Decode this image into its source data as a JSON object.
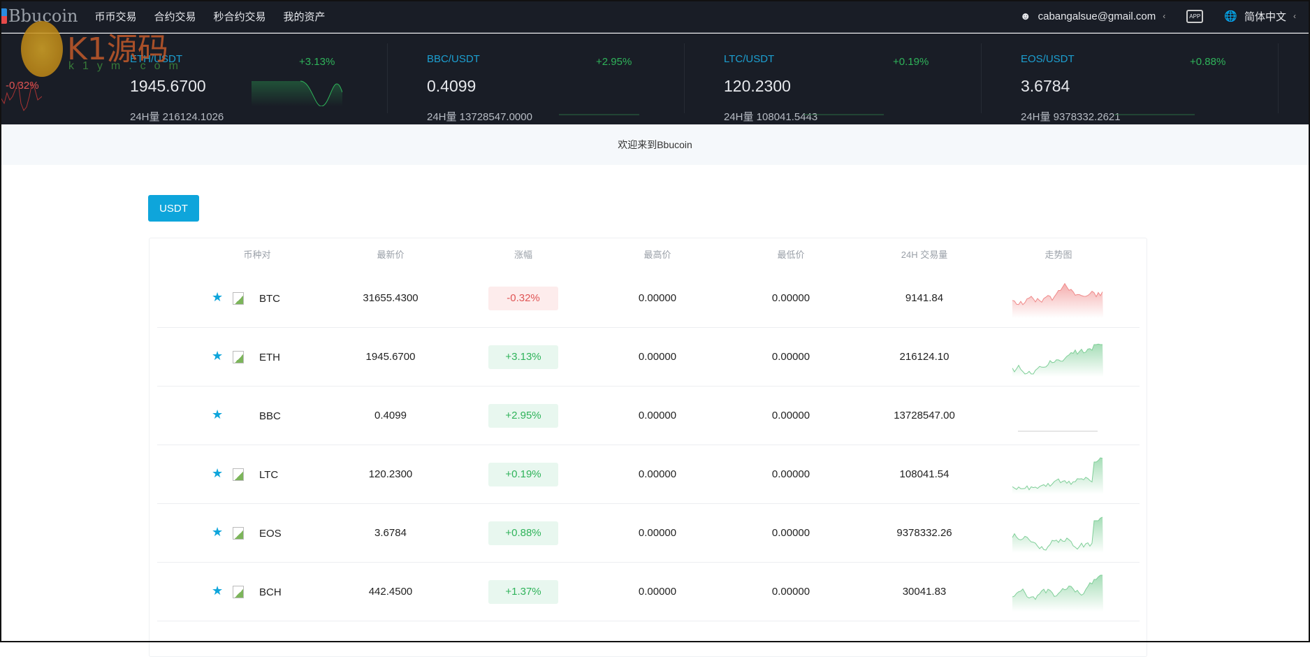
{
  "header": {
    "brand": "Bbucoin",
    "nav": [
      "币币交易",
      "合约交易",
      "秒合约交易",
      "我的资产"
    ],
    "user_email": "cabangalsue@gmail.com",
    "app_icon": "APP",
    "language": "简体中文"
  },
  "watermark": {
    "text": "K1源码",
    "url": "k1ym.com"
  },
  "ticker": {
    "side_change": "-0.32%",
    "items": [
      {
        "pair": "ETH/USDT",
        "change": "+3.13%",
        "price": "1945.6700",
        "volume": "24H量 216124.1026"
      },
      {
        "pair": "BBC/USDT",
        "change": "+2.95%",
        "price": "0.4099",
        "volume": "24H量 13728547.0000"
      },
      {
        "pair": "LTC/USDT",
        "change": "+0.19%",
        "price": "120.2300",
        "volume": "24H量 108041.5443"
      },
      {
        "pair": "EOS/USDT",
        "change": "+0.88%",
        "price": "3.6784",
        "volume": "24H量 9378332.2621"
      }
    ]
  },
  "welcome": "欢迎来到Bbucoin",
  "market_tab": "USDT",
  "table": {
    "headers": [
      "币种对",
      "最新价",
      "涨幅",
      "最高价",
      "最低价",
      "24H 交易量",
      "走势图"
    ],
    "rows": [
      {
        "coin": "BTC",
        "price": "31655.4300",
        "change": "-0.32%",
        "high": "0.00000",
        "low": "0.00000",
        "volume": "9141.84",
        "trend": "down",
        "img": true
      },
      {
        "coin": "ETH",
        "price": "1945.6700",
        "change": "+3.13%",
        "high": "0.00000",
        "low": "0.00000",
        "volume": "216124.10",
        "trend": "up",
        "img": true
      },
      {
        "coin": "BBC",
        "price": "0.4099",
        "change": "+2.95%",
        "high": "0.00000",
        "low": "0.00000",
        "volume": "13728547.00",
        "trend": "flat",
        "img": false
      },
      {
        "coin": "LTC",
        "price": "120.2300",
        "change": "+0.19%",
        "high": "0.00000",
        "low": "0.00000",
        "volume": "108041.54",
        "trend": "up",
        "img": true
      },
      {
        "coin": "EOS",
        "price": "3.6784",
        "change": "+0.88%",
        "high": "0.00000",
        "low": "0.00000",
        "volume": "9378332.26",
        "trend": "up",
        "img": true
      },
      {
        "coin": "BCH",
        "price": "442.4500",
        "change": "+1.37%",
        "high": "0.00000",
        "low": "0.00000",
        "volume": "30041.83",
        "trend": "up",
        "img": true
      }
    ]
  },
  "colors": {
    "accent": "#0ea5db",
    "up": "#2fb35a",
    "down": "#e05555",
    "up_bg": "#e8f7ef",
    "down_bg": "#fdecec",
    "dark": "#191d26"
  }
}
